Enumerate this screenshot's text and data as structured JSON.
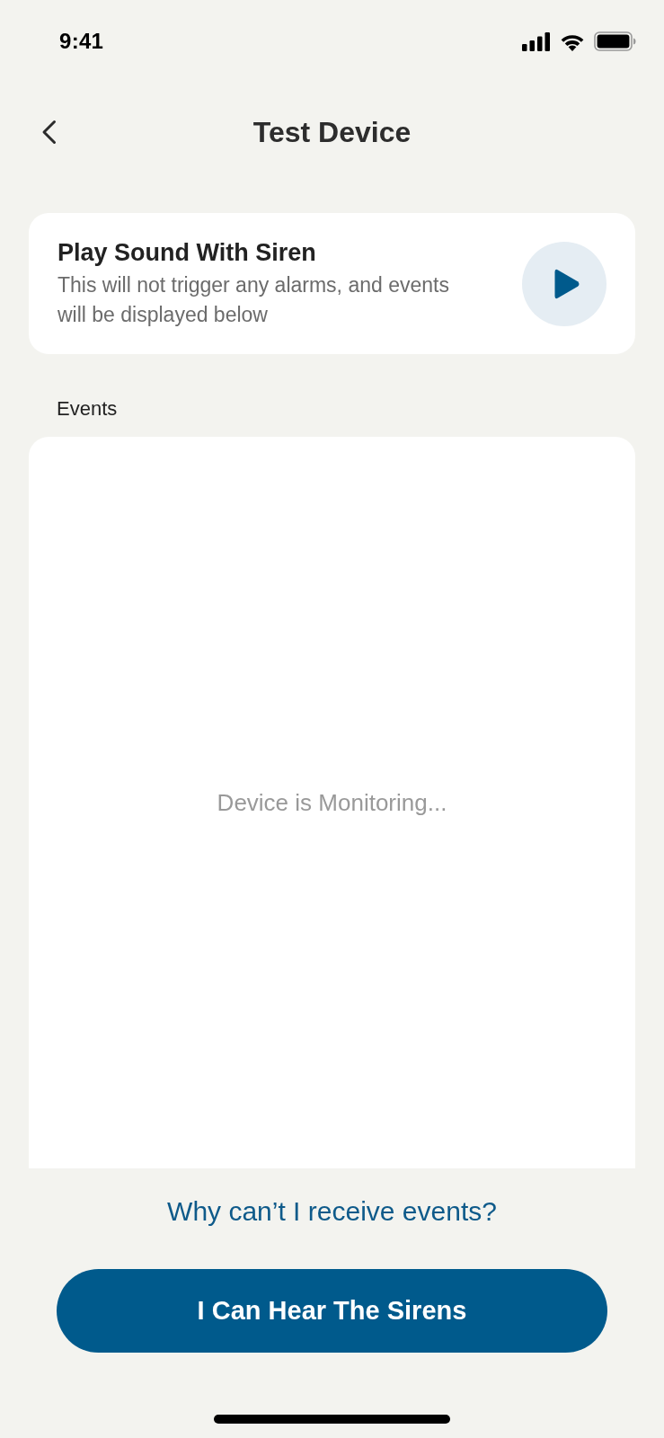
{
  "status_bar": {
    "time": "9:41"
  },
  "header": {
    "title": "Test Device"
  },
  "sound_card": {
    "title": "Play Sound With Siren",
    "description": "This will not trigger any alarms, and events will be displayed below"
  },
  "events": {
    "label": "Events",
    "empty_message": "Device is Monitoring..."
  },
  "help_link": "Why can’t I receive events?",
  "primary_button": "I Can Hear The Sirens"
}
